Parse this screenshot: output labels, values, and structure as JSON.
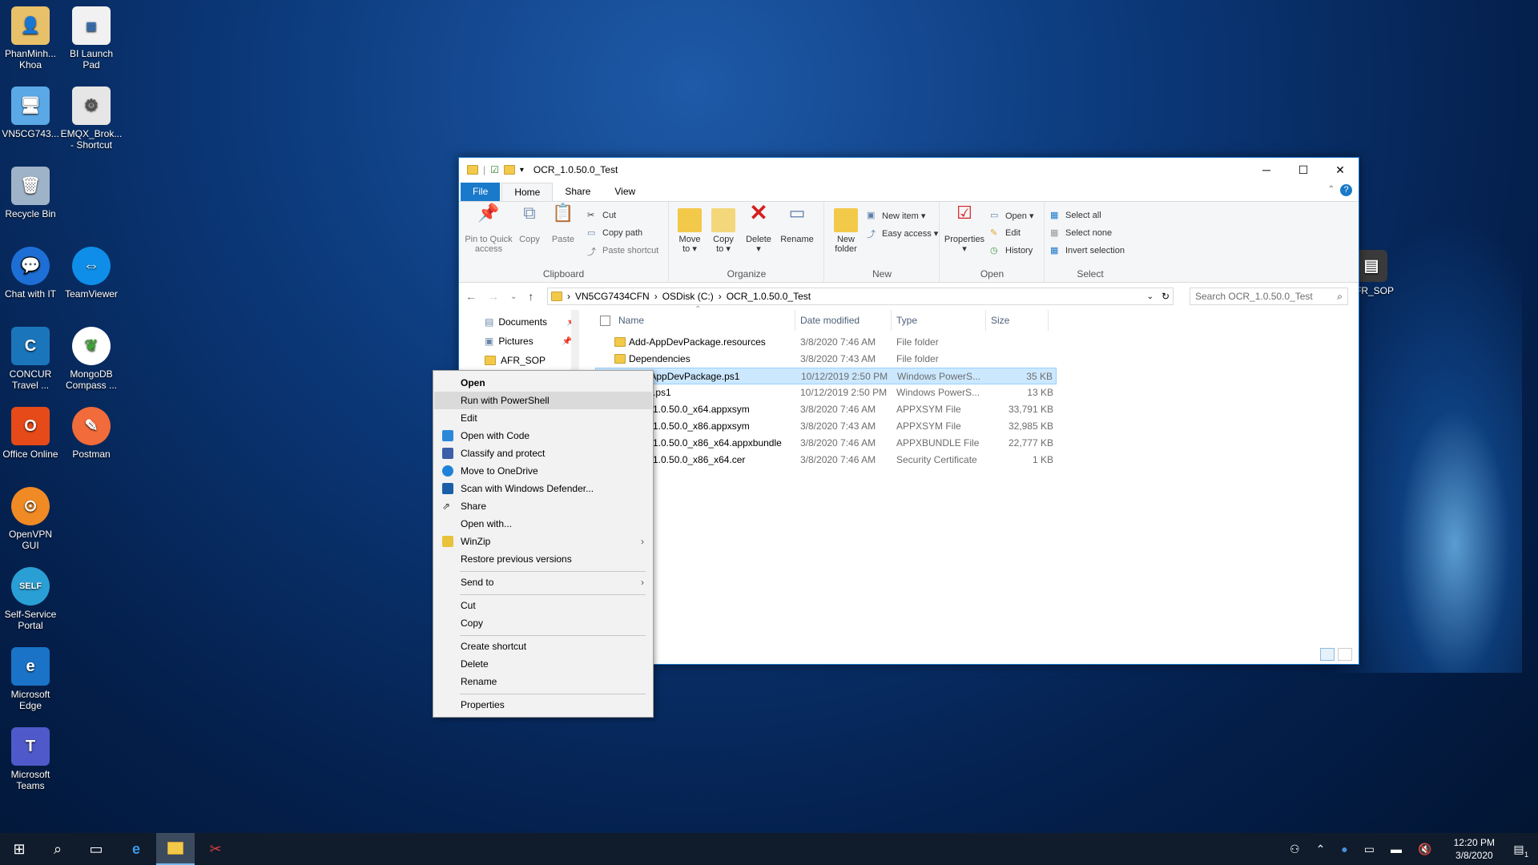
{
  "desktop": {
    "icons": [
      {
        "label": "PhanMinh...\nKhoa",
        "icon": "user-folder-icon"
      },
      {
        "label": "BI Launch\nPad",
        "icon": "bi-launchpad-icon"
      },
      {
        "label": "VN5CG743...",
        "icon": "computer-icon"
      },
      {
        "label": "EMQX_Brok...\n- Shortcut",
        "icon": "emqx-shortcut-icon"
      },
      {
        "label": "Recycle Bin",
        "icon": "recycle-bin-icon"
      },
      {
        "label": "Chat with IT",
        "icon": "chat-icon"
      },
      {
        "label": "TeamViewer",
        "icon": "teamviewer-icon"
      },
      {
        "label": "CONCUR\nTravel ...",
        "icon": "concur-icon"
      },
      {
        "label": "MongoDB\nCompass ...",
        "icon": "mongodb-icon"
      },
      {
        "label": "Office Online",
        "icon": "office-icon"
      },
      {
        "label": "Postman",
        "icon": "postman-icon"
      },
      {
        "label": "OpenVPN\nGUI",
        "icon": "openvpn-icon"
      },
      {
        "label": "Self-Service\nPortal",
        "icon": "self-service-icon"
      },
      {
        "label": "Microsoft\nEdge",
        "icon": "edge-icon"
      },
      {
        "label": "Microsoft\nTeams",
        "icon": "teams-icon"
      },
      {
        "label": "AFR_SOP",
        "icon": "archive-icon"
      }
    ]
  },
  "explorer": {
    "title": "OCR_1.0.50.0_Test",
    "tabs": {
      "file": "File",
      "home": "Home",
      "share": "Share",
      "view": "View"
    },
    "ribbon": {
      "clipboard": {
        "label": "Clipboard",
        "pin": "Pin to Quick\naccess",
        "copy": "Copy",
        "paste": "Paste",
        "cut": "Cut",
        "copy_path": "Copy path",
        "paste_shortcut": "Paste shortcut"
      },
      "organize": {
        "label": "Organize",
        "move_to": "Move\nto ▾",
        "copy_to": "Copy\nto ▾",
        "delete": "Delete\n▾",
        "rename": "Rename"
      },
      "new": {
        "label": "New",
        "new_folder": "New\nfolder",
        "new_item": "New item ▾",
        "easy_access": "Easy access ▾"
      },
      "open": {
        "label": "Open",
        "properties": "Properties\n▾",
        "open": "Open ▾",
        "edit": "Edit",
        "history": "History"
      },
      "select": {
        "label": "Select",
        "select_all": "Select all",
        "select_none": "Select none",
        "invert": "Invert selection"
      }
    },
    "address": {
      "crumbs": [
        "VN5CG7434CFN",
        "OSDisk (C:)",
        "OCR_1.0.50.0_Test"
      ],
      "search_placeholder": "Search OCR_1.0.50.0_Test"
    },
    "nav_pane": [
      "Documents",
      "Pictures",
      "AFR_SOP"
    ],
    "columns": {
      "name": "Name",
      "date": "Date modified",
      "type": "Type",
      "size": "Size"
    },
    "files": [
      {
        "name": "Add-AppDevPackage.resources",
        "date": "3/8/2020 7:46 AM",
        "type": "File folder",
        "size": ""
      },
      {
        "name": "Dependencies",
        "date": "3/8/2020 7:43 AM",
        "type": "File folder",
        "size": ""
      },
      {
        "name": "Add-AppDevPackage.ps1",
        "date": "10/12/2019 2:50 PM",
        "type": "Windows PowerS...",
        "size": "35 KB"
      },
      {
        "name": ".ps1",
        "date": "10/12/2019 2:50 PM",
        "type": "Windows PowerS...",
        "size": "13 KB"
      },
      {
        "name": "1.0.50.0_x64.appxsym",
        "date": "3/8/2020 7:46 AM",
        "type": "APPXSYM File",
        "size": "33,791 KB"
      },
      {
        "name": "1.0.50.0_x86.appxsym",
        "date": "3/8/2020 7:43 AM",
        "type": "APPXSYM File",
        "size": "32,985 KB"
      },
      {
        "name": "1.0.50.0_x86_x64.appxbundle",
        "date": "3/8/2020 7:46 AM",
        "type": "APPXBUNDLE File",
        "size": "22,777 KB"
      },
      {
        "name": "1.0.50.0_x86_x64.cer",
        "date": "3/8/2020 7:46 AM",
        "type": "Security Certificate",
        "size": "1 KB"
      }
    ]
  },
  "context_menu": {
    "open": "Open",
    "run_powershell": "Run with PowerShell",
    "edit": "Edit",
    "open_with_code": "Open with Code",
    "classify": "Classify and protect",
    "onedrive": "Move to OneDrive",
    "defender": "Scan with Windows Defender...",
    "share": "Share",
    "open_with": "Open with...",
    "winzip": "WinZip",
    "restore": "Restore previous versions",
    "send_to": "Send to",
    "cut": "Cut",
    "copy": "Copy",
    "create_shortcut": "Create shortcut",
    "delete": "Delete",
    "rename": "Rename",
    "properties": "Properties"
  },
  "taskbar": {
    "time": "12:20 PM",
    "date": "3/8/2020",
    "notification_count": "1"
  },
  "colors": {
    "accent": "#1979ca",
    "selection": "#cce8ff",
    "taskbar": "#101b2b"
  }
}
